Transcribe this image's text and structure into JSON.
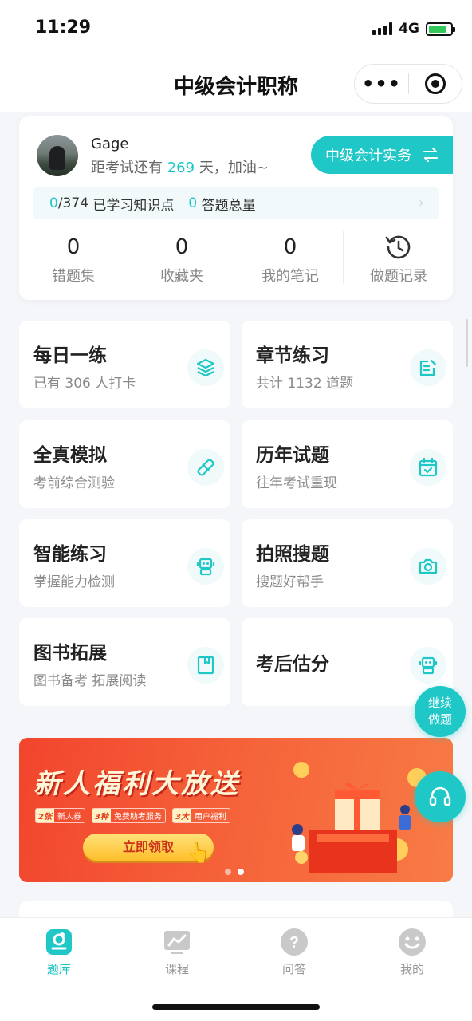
{
  "status_bar": {
    "time": "11:29",
    "network": "4G"
  },
  "nav": {
    "title": "中级会计职称"
  },
  "profile": {
    "name": "Gage",
    "countdown_prefix": "距考试还有 ",
    "countdown_days": "269",
    "countdown_suffix": " 天，加油~",
    "subject_button": "中级会计实务"
  },
  "progress": {
    "learned": "0",
    "total": "/374",
    "learned_label": "已学习知识点",
    "answered": "0",
    "answered_label": "答题总量"
  },
  "stats": [
    {
      "value": "0",
      "label": "错题集"
    },
    {
      "value": "0",
      "label": "收藏夹"
    },
    {
      "value": "0",
      "label": "我的笔记"
    },
    {
      "label": "做题记录",
      "icon": "history-icon"
    }
  ],
  "tiles": [
    {
      "title": "每日一练",
      "subtitle": "已有 306 人打卡",
      "icon": "layers-icon"
    },
    {
      "title": "章节练习",
      "subtitle": "共计 1132 道题",
      "icon": "edit-icon"
    },
    {
      "title": "全真模拟",
      "subtitle": "考前综合测验",
      "icon": "pen-icon"
    },
    {
      "title": "历年试题",
      "subtitle": "往年考试重现",
      "icon": "calendar-icon"
    },
    {
      "title": "智能练习",
      "subtitle": "掌握能力检测",
      "icon": "robot-icon"
    },
    {
      "title": "拍照搜题",
      "subtitle": "搜题好帮手",
      "icon": "camera-icon"
    },
    {
      "title": "图书拓展",
      "subtitle": "图书备考 拓展阅读",
      "icon": "book-icon"
    },
    {
      "title": "考后估分",
      "subtitle": "",
      "icon": "robot-icon"
    }
  ],
  "float": {
    "continue_line1": "继续",
    "continue_line2": "做题"
  },
  "banner": {
    "title": "新人福利大放送",
    "tags": [
      {
        "k": "2张",
        "v": "新人券"
      },
      {
        "k": "3种",
        "v": "免费助考服务"
      },
      {
        "k": "3大",
        "v": "用户福利"
      }
    ],
    "cta": "立即领取"
  },
  "tabbar": [
    {
      "label": "题库",
      "active": true
    },
    {
      "label": "课程",
      "active": false
    },
    {
      "label": "问答",
      "active": false
    },
    {
      "label": "我的",
      "active": false
    }
  ],
  "colors": {
    "accent": "#1fc7c7",
    "banner": "#f2452d"
  }
}
